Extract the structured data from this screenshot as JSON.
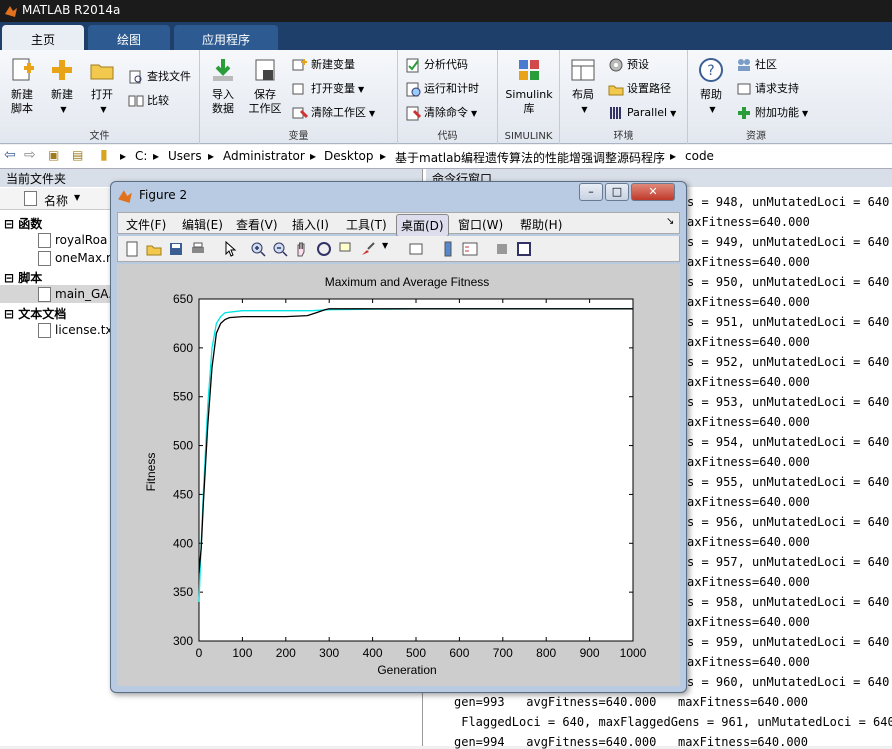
{
  "app": {
    "title": "MATLAB R2014a"
  },
  "tabs": [
    {
      "label": "主页",
      "active": true
    },
    {
      "label": "绘图",
      "active": false
    },
    {
      "label": "应用程序",
      "active": false
    }
  ],
  "ribbon": {
    "file": {
      "label": "文件",
      "new_script": "新建\n脚本",
      "new": "新建",
      "open": "打开",
      "find_files": "查找文件",
      "compare": "比较"
    },
    "variable": {
      "label": "变量",
      "import": "导入\n数据",
      "save": "保存\n工作区",
      "new_var": "新建变量",
      "open_var": "打开变量",
      "clear_ws": "清除工作区"
    },
    "code": {
      "label": "代码",
      "analyze": "分析代码",
      "run_time": "运行和计时",
      "clear_cmd": "清除命令"
    },
    "simulink": {
      "label": "SIMULINK",
      "lib": "Simulink\n库"
    },
    "env": {
      "label": "环境",
      "layout": "布局",
      "prefs": "预设",
      "set_path": "设置路径",
      "parallel": "Parallel"
    },
    "resources": {
      "label": "资源",
      "help": "帮助",
      "community": "社区",
      "support": "请求支持",
      "addons": "附加功能"
    }
  },
  "address": [
    "C:",
    "Users",
    "Administrator",
    "Desktop",
    "基于matlab编程遗传算法的性能增强调整源码程序",
    "code"
  ],
  "current_folder": {
    "title": "当前文件夹",
    "column": "名称",
    "items": [
      {
        "type": "category",
        "label": "函数"
      },
      {
        "type": "file",
        "label": "royalRoa"
      },
      {
        "type": "file",
        "label": "oneMax.m"
      },
      {
        "type": "category",
        "label": "脚本"
      },
      {
        "type": "file",
        "label": "main_GA.",
        "selected": true
      },
      {
        "type": "category",
        "label": "文本文档"
      },
      {
        "type": "file",
        "label": "license.txt"
      }
    ]
  },
  "command_window": {
    "title": "命令行窗口",
    "lines": [
      "s = 948, unMutatedLoci = 640",
      "axFitness=640.000",
      "s = 949, unMutatedLoci = 640",
      "axFitness=640.000",
      "s = 950, unMutatedLoci = 640",
      "axFitness=640.000",
      "s = 951, unMutatedLoci = 640",
      "axFitness=640.000",
      "s = 952, unMutatedLoci = 640",
      "axFitness=640.000",
      "s = 953, unMutatedLoci = 640",
      "axFitness=640.000",
      "s = 954, unMutatedLoci = 640",
      "axFitness=640.000",
      "s = 955, unMutatedLoci = 640",
      "axFitness=640.000",
      "s = 956, unMutatedLoci = 640",
      "axFitness=640.000",
      "s = 957, unMutatedLoci = 640",
      "axFitness=640.000",
      "s = 958, unMutatedLoci = 640",
      "axFitness=640.000",
      "s = 959, unMutatedLoci = 640",
      "axFitness=640.000",
      "s = 960, unMutatedLoci = 640",
      "gen=993   avgFitness=640.000   maxFitness=640.000",
      " FlaggedLoci = 640, maxFlaggedGens = 961, unMutatedLoci = 640",
      "gen=994   avgFitness=640.000   maxFitness=640.000"
    ]
  },
  "figure": {
    "title": "Figure 2",
    "menus": [
      "文件(F)",
      "编辑(E)",
      "查看(V)",
      "插入(I)",
      "工具(T)",
      "桌面(D)",
      "窗口(W)",
      "帮助(H)"
    ]
  },
  "chart_data": {
    "type": "line",
    "title": "Maximum and Average Fitness",
    "xlabel": "Generation",
    "ylabel": "Fitness",
    "xlim": [
      0,
      1000
    ],
    "ylim": [
      300,
      650
    ],
    "xticks": [
      0,
      100,
      200,
      300,
      400,
      500,
      600,
      700,
      800,
      900,
      1000
    ],
    "yticks": [
      300,
      350,
      400,
      450,
      500,
      550,
      600,
      650
    ],
    "series": [
      {
        "color": "#00e5e5",
        "x": [
          0,
          5,
          10,
          20,
          30,
          40,
          50,
          60,
          80,
          100,
          200,
          260,
          300,
          500,
          1000
        ],
        "y": [
          340,
          400,
          450,
          540,
          600,
          625,
          632,
          636,
          637,
          638,
          638,
          638,
          639,
          640,
          640
        ]
      },
      {
        "color": "#000000",
        "x": [
          0,
          5,
          10,
          20,
          30,
          40,
          50,
          60,
          70,
          100,
          150,
          200,
          250,
          270,
          290,
          300,
          500,
          1000
        ],
        "y": [
          370,
          395,
          440,
          520,
          580,
          615,
          625,
          629,
          631,
          632,
          632,
          632,
          633,
          636,
          639,
          640,
          640,
          640
        ]
      }
    ]
  }
}
